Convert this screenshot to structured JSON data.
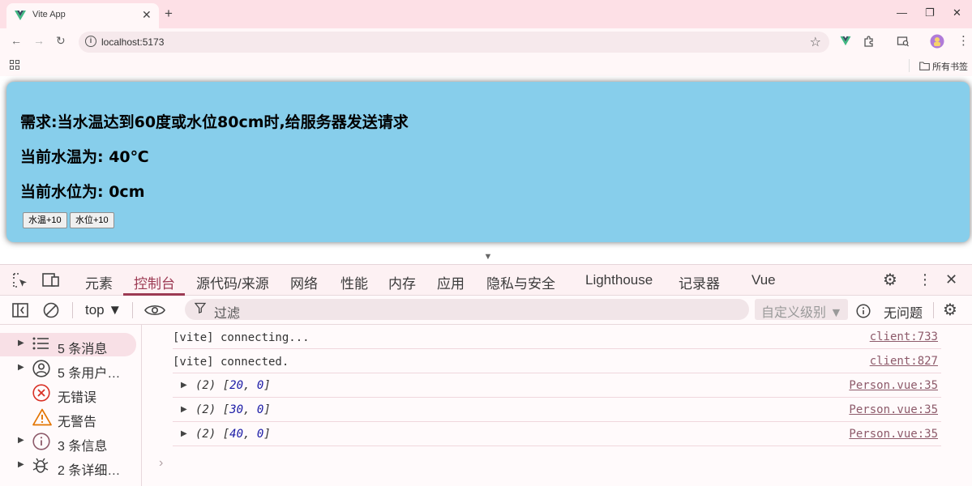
{
  "browser": {
    "tab_title": "Vite App",
    "tab_close": "✕",
    "new_tab": "+",
    "window_controls": {
      "minimize": "—",
      "restore": "❐",
      "close": "✕"
    },
    "nav": {
      "back": "←",
      "forward": "→",
      "reload": "↻"
    },
    "url": "localhost:5173",
    "bookmark_star": "☆",
    "bookmarks_folder": "所有书签",
    "colors": {
      "tabstrip": "#fde0e6",
      "toolbar": "#fff7f8",
      "vue_green": "#41b883"
    }
  },
  "page": {
    "requirement": "需求:当水温达到60度或水位80cm时,给服务器发送请求",
    "temp_text": "当前水温为: 40℃",
    "height_text": "当前水位为: 0cm",
    "temp_button": "水温+10",
    "height_button": "水位+10",
    "card_color": "#87ceeb"
  },
  "devtools": {
    "tabs": [
      "元素",
      "控制台",
      "源代码/来源",
      "网络",
      "性能",
      "内存",
      "应用",
      "隐私与安全",
      "Lighthouse",
      "记录器",
      "Vue"
    ],
    "active_tab": "控制台",
    "context": "top ▼",
    "filter_placeholder": "过滤",
    "levels": "自定义级别 ▼",
    "issues": "无问题",
    "accent": "#9c3a53",
    "sidebar": [
      {
        "label": "5 条消息",
        "icon": "list-icon",
        "expandable": true
      },
      {
        "label": "5 条用户…",
        "icon": "user-icon",
        "expandable": true
      },
      {
        "label": "无错误",
        "icon": "error-icon",
        "expandable": false
      },
      {
        "label": "无警告",
        "icon": "warning-icon",
        "expandable": false
      },
      {
        "label": "3 条信息",
        "icon": "info-icon",
        "expandable": true
      },
      {
        "label": "2 条详细…",
        "icon": "bug-icon",
        "expandable": true
      }
    ],
    "logs": [
      {
        "text": "[vite] connecting...",
        "source": "client:733"
      },
      {
        "text": "[vite] connected.",
        "source": "client:827"
      },
      {
        "count": "(2)",
        "open": " [",
        "a": "20",
        "sep": ", ",
        "b": "0",
        "close": "]",
        "source": "Person.vue:35"
      },
      {
        "count": "(2)",
        "open": " [",
        "a": "30",
        "sep": ", ",
        "b": "0",
        "close": "]",
        "source": "Person.vue:35"
      },
      {
        "count": "(2)",
        "open": " [",
        "a": "40",
        "sep": ", ",
        "b": "0",
        "close": "]",
        "source": "Person.vue:35"
      }
    ],
    "prompt": "›"
  }
}
